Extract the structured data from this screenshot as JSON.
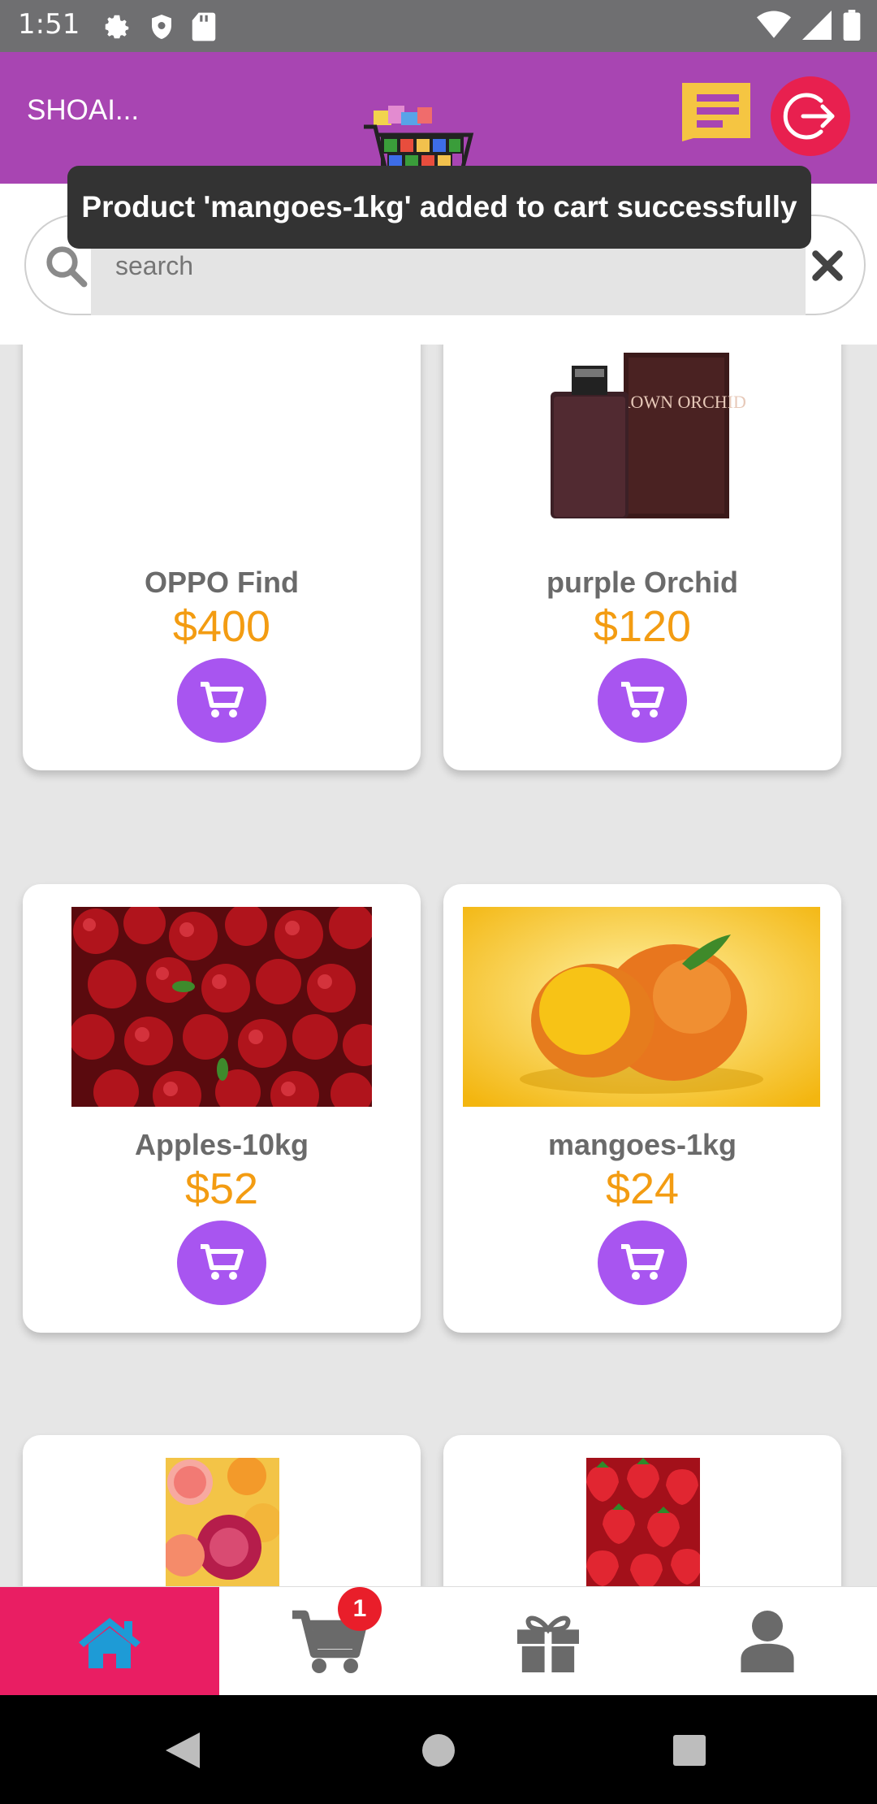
{
  "status_bar": {
    "time": "1:51"
  },
  "header": {
    "user_name": "SHOAI..."
  },
  "toast": {
    "message": "Product 'mangoes-1kg' added to cart successfully"
  },
  "search": {
    "placeholder": "search",
    "value": ""
  },
  "products": [
    {
      "name": "OPPO Find",
      "price": "$400"
    },
    {
      "name": "purple Orchid",
      "price": "$120",
      "image_text": "BROWN ORCHID"
    },
    {
      "name": "Apples-10kg",
      "price": "$52"
    },
    {
      "name": "mangoes-1kg",
      "price": "$24"
    },
    {
      "name": "",
      "price": ""
    },
    {
      "name": "",
      "price": ""
    }
  ],
  "bottom_nav": {
    "items": [
      "home-icon",
      "cart-icon",
      "gift-icon",
      "user-icon"
    ],
    "active": "home",
    "cart_badge": "1"
  },
  "colors": {
    "header": "#a845b2",
    "accent_price": "#f39c12",
    "cart_button": "#a855f0",
    "nav_active": "#e91e63",
    "logout": "#e8204f"
  }
}
